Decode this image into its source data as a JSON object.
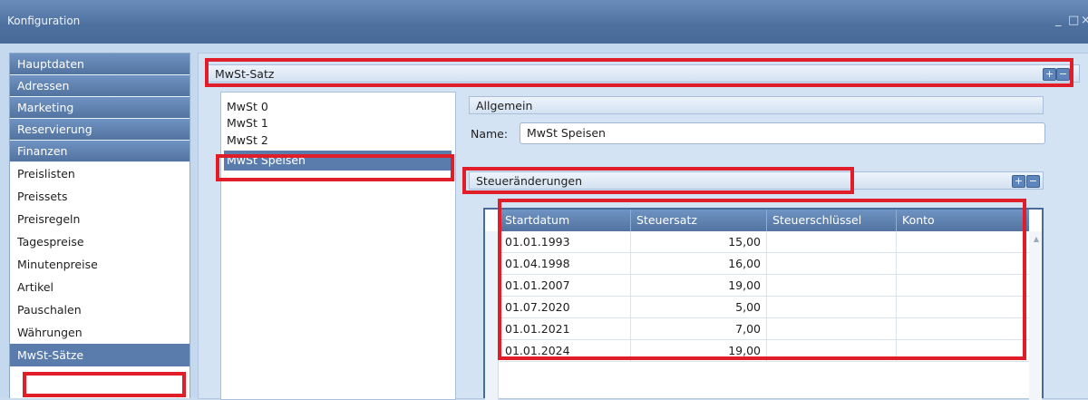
{
  "window": {
    "title": "Konfiguration"
  },
  "nav": {
    "categories": [
      "Hauptdaten",
      "Adressen",
      "Marketing",
      "Reservierung",
      "Finanzen"
    ],
    "items": [
      "Preislisten",
      "Preissets",
      "Preisregeln",
      "Tagespreise",
      "Minutenpreise",
      "Artikel",
      "Pauschalen",
      "Währungen",
      "MwSt-Sätze"
    ],
    "selected": "MwSt-Sätze"
  },
  "mwst_panel": {
    "title": "MwSt-Satz",
    "items": [
      "MwSt 0",
      "MwSt 1",
      "MwSt 2",
      "MwSt Speisen"
    ],
    "selected": "MwSt Speisen"
  },
  "allgemein": {
    "title": "Allgemein",
    "name_label": "Name:",
    "name_value": "MwSt Speisen"
  },
  "steuer": {
    "title": "Steueränderungen",
    "columns": [
      "Startdatum",
      "Steuersatz",
      "Steuerschlüssel",
      "Konto"
    ],
    "rows": [
      [
        "01.01.1993",
        "15,00",
        "",
        ""
      ],
      [
        "01.04.1998",
        "16,00",
        "",
        ""
      ],
      [
        "01.01.2007",
        "19,00",
        "",
        ""
      ],
      [
        "01.07.2020",
        "5,00",
        "",
        ""
      ],
      [
        "01.01.2021",
        "7,00",
        "",
        ""
      ],
      [
        "01.01.2024",
        "19,00",
        "",
        ""
      ]
    ]
  },
  "icons": {
    "add": "plus-icon",
    "collapse": "minus-icon",
    "minimize": "minimize-icon",
    "maximize": "maximize-icon",
    "close": "close-icon"
  },
  "colors": {
    "highlight": "#e01e2a",
    "nav_header": "#5a7cac"
  },
  "symbols": {
    "plus": "+",
    "minus": "−",
    "min": "_",
    "max": "□",
    "close": "×",
    "up": "▲"
  }
}
